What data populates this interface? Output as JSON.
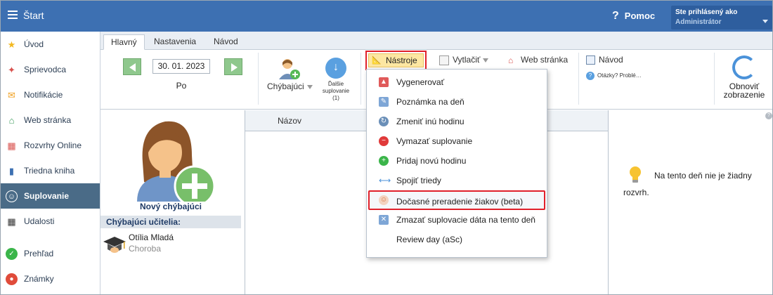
{
  "app": {
    "title": "Štart",
    "help": "Pomoc",
    "user_label": "Ste prihlásený ako",
    "user_name": "Administrátor"
  },
  "sidebar": {
    "items": [
      {
        "label": "Úvod",
        "icon": "star-icon"
      },
      {
        "label": "Sprievodca",
        "icon": "magic-wand-icon"
      },
      {
        "label": "Notifikácie",
        "icon": "envelope-icon"
      },
      {
        "label": "Web stránka",
        "icon": "house-icon"
      },
      {
        "label": "Rozvrhy Online",
        "icon": "grid-icon"
      },
      {
        "label": "Triedna kniha",
        "icon": "book-icon"
      },
      {
        "label": "Suplovanie",
        "icon": "user-icon",
        "active": true
      },
      {
        "label": "Udalosti",
        "icon": "calendar-icon"
      },
      {
        "label": "Prehľad",
        "icon": "check-icon"
      },
      {
        "label": "Známky",
        "icon": "grade-icon"
      }
    ]
  },
  "tabs": [
    "Hlavný",
    "Nastavenia",
    "Návod"
  ],
  "ribbon": {
    "date": "30. 01. 2023",
    "day": "Po",
    "chybajuci": "Chýbajúci",
    "dalsie": [
      "Ďalšie",
      "suplovanie",
      "(1)"
    ],
    "nastroje": "Nástroje",
    "vytlacit": "Vytlačiť",
    "web": "Web stránka",
    "navod": "Návod",
    "otazky": "Otázky? Problé…",
    "obnovit": [
      "Obnoviť",
      "zobrazenie"
    ]
  },
  "left": {
    "new_absent": "Nový chýbajúci",
    "absent_header": "Chýbajúci učitelia:",
    "teacher_name": "Otília Mladá",
    "teacher_status": "Choroba"
  },
  "table": {
    "col_name": "Názov"
  },
  "right": {
    "msg_line1": "Na tento deň nie je žiadny",
    "msg_line2": "rozvrh."
  },
  "menu": {
    "items": [
      "Vygenerovať",
      "Poznámka na deň",
      "Zmeniť inú hodinu",
      "Vymazať suplovanie",
      "Pridaj novú hodinu",
      "Spojiť triedy",
      "Dočasné preradenie žiakov (beta)",
      "Zmazať suplovacie dáta na tento deň",
      "Review day (aSc)"
    ]
  },
  "colors": {
    "topbar": "#3d70b2",
    "sidebar_active": "#4a6b87",
    "highlight": "#e0202a",
    "accent_green": "#8fc88d"
  }
}
